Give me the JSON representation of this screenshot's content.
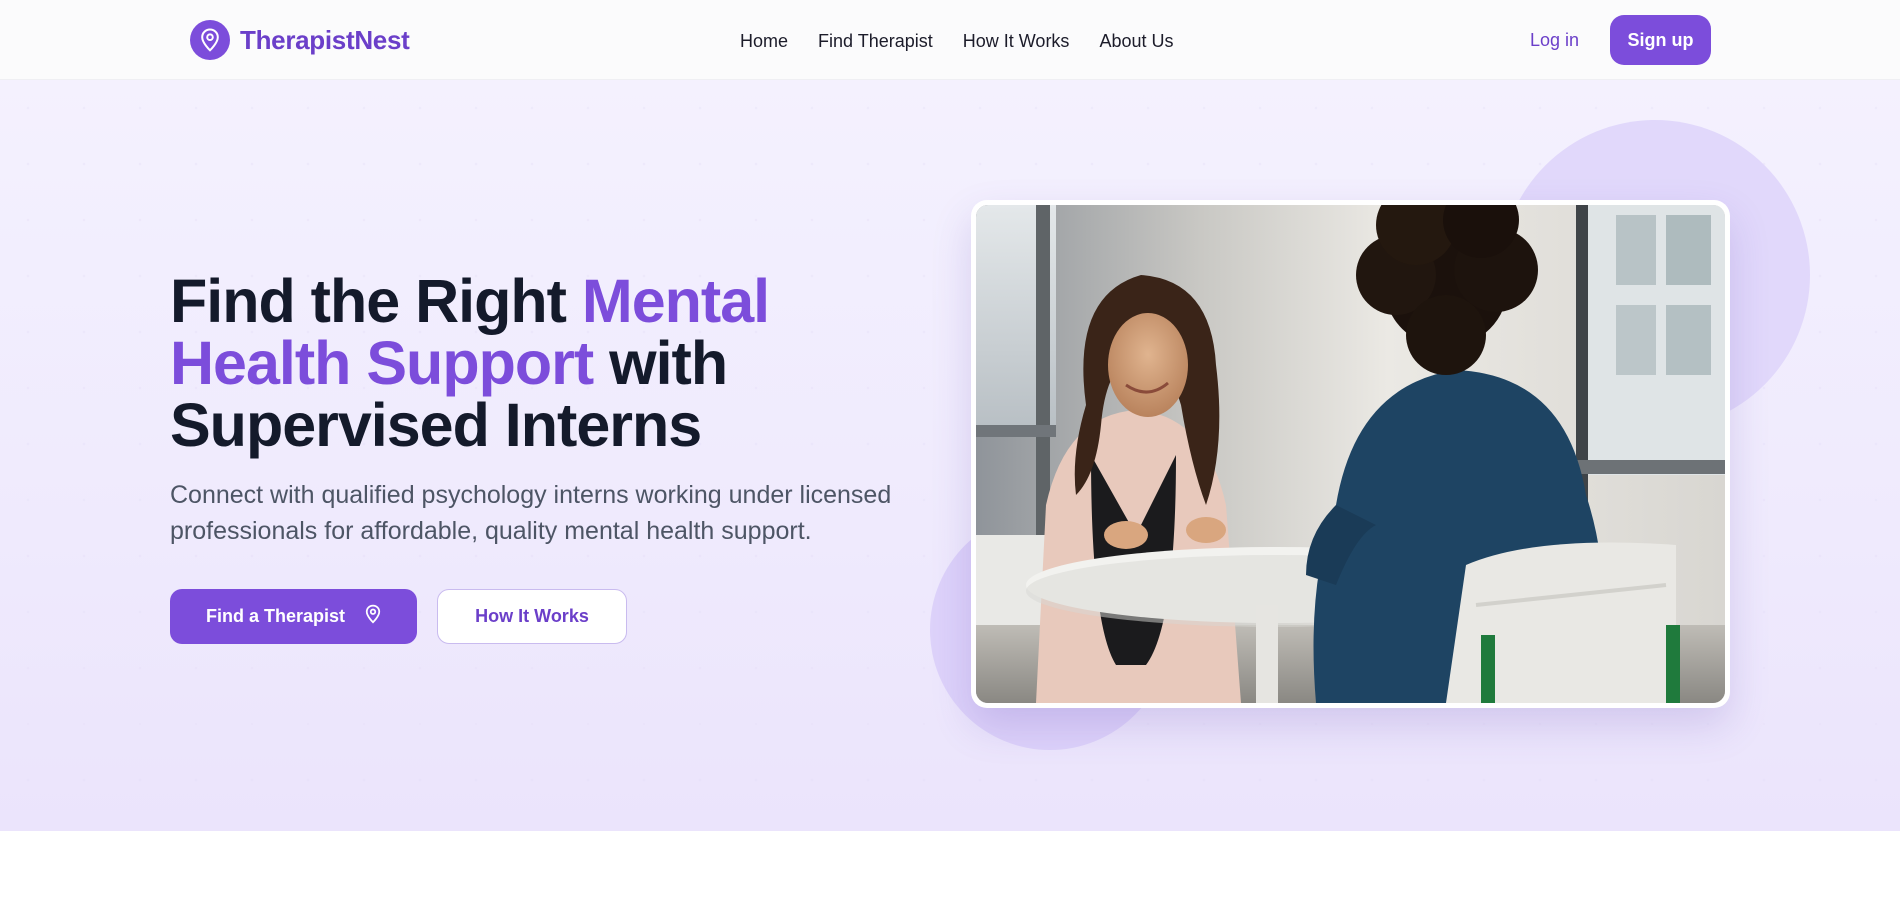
{
  "brand": {
    "name": "TherapistNest",
    "logo_icon": "map-pin-icon"
  },
  "nav": {
    "links": [
      "Home",
      "Find Therapist",
      "How It Works",
      "About Us"
    ],
    "login_label": "Log in",
    "signup_label": "Sign up"
  },
  "hero": {
    "title_part1": "Find the Right ",
    "title_accent": "Mental Health Support",
    "title_part2": " with Supervised Interns",
    "subtitle": "Connect with qualified psychology interns working under licensed professionals for affordable, quality mental health support.",
    "primary_button": {
      "label": "Find a Therapist",
      "icon": "map-pin-icon"
    },
    "secondary_button": {
      "label": "How It Works"
    },
    "image_icon": "therapy-session-photo"
  },
  "colors": {
    "brand": "#7c4ddb",
    "brand_text": "#6b3fc9",
    "heading": "#141a2b",
    "body_text": "#4d5565",
    "hero_bg": "#f1edfd"
  }
}
